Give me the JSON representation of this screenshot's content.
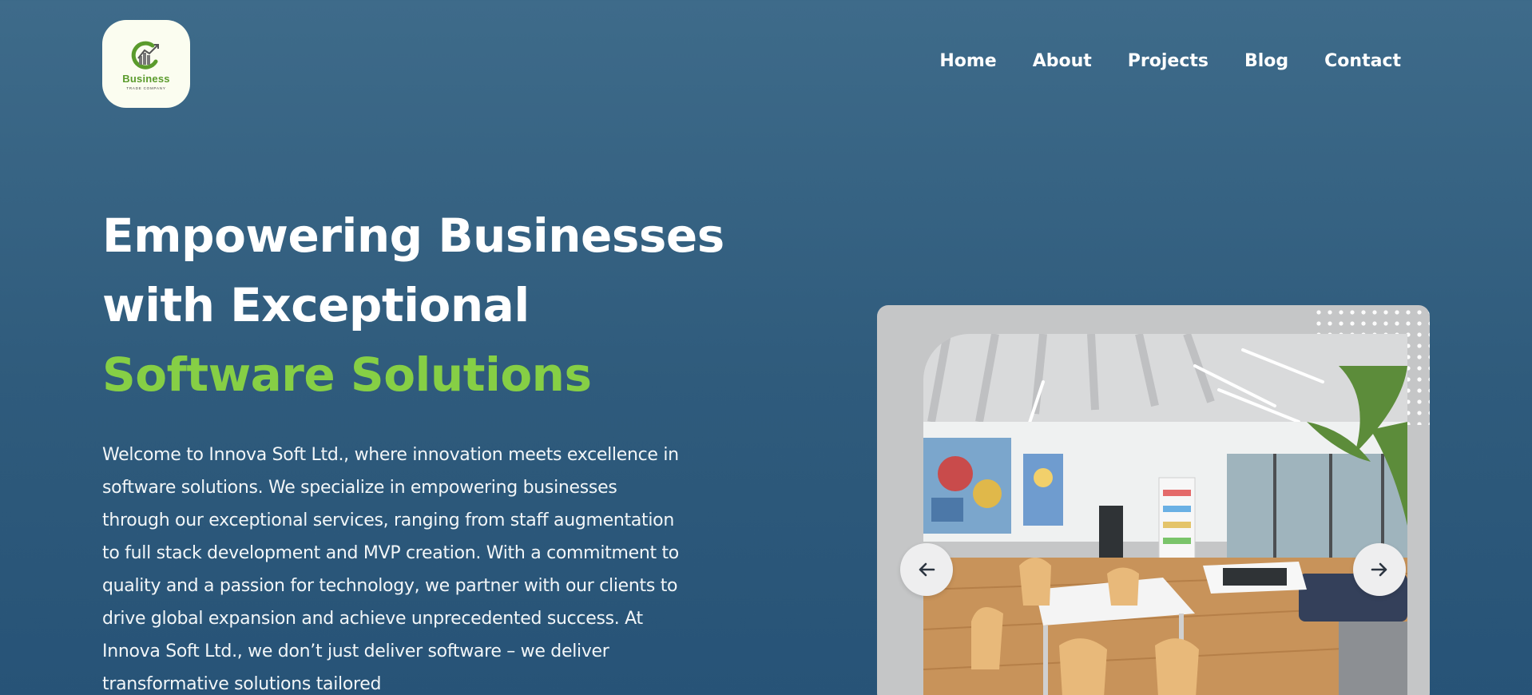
{
  "logo": {
    "word": "Business",
    "sub": "TRADE COMPANY",
    "icon": "business-logo-icon",
    "colors": {
      "green": "#5a9b2c",
      "dark": "#555555",
      "background": "#fbfdf0"
    }
  },
  "nav": {
    "items": [
      {
        "label": "Home"
      },
      {
        "label": "About"
      },
      {
        "label": "Projects"
      },
      {
        "label": "Blog"
      },
      {
        "label": "Contact"
      }
    ]
  },
  "hero": {
    "title_line1": "Empowering Businesses",
    "title_line2": "with Exceptional",
    "title_accent": "Software Solutions",
    "description": "Welcome to Innova Soft Ltd., where innovation meets excellence in software solutions. We specialize in empowering businesses through our exceptional services, ranging from staff augmentation to full stack development and MVP creation. With a commitment to quality and a passion for technology, we partner with our clients to drive global expansion and achieve unprecedented success. At Innova Soft Ltd., we don’t just deliver software – we deliver transformative solutions tailored",
    "accent_color": "#86cf45"
  },
  "gallery": {
    "prev_icon": "arrow-left-icon",
    "next_icon": "arrow-right-icon",
    "card_color": "#c5c6c7"
  }
}
